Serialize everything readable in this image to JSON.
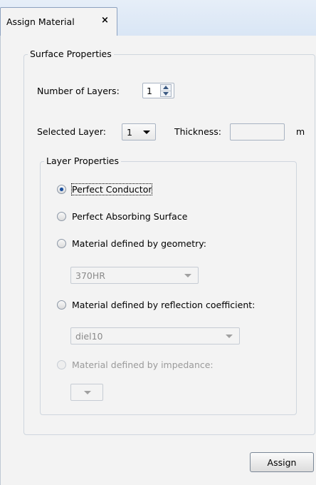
{
  "tab": {
    "title": "Assign Material",
    "close_label": "×"
  },
  "surface_properties": {
    "title": "Surface Properties",
    "number_of_layers_label": "Number of Layers:",
    "number_of_layers_value": "1",
    "selected_layer_label": "Selected Layer:",
    "selected_layer_value": "1",
    "thickness_label": "Thickness:",
    "thickness_value": "",
    "thickness_unit": "m"
  },
  "layer_properties": {
    "title": "Layer Properties",
    "options": [
      {
        "label": "Perfect Conductor",
        "checked": true,
        "enabled": true
      },
      {
        "label": "Perfect Absorbing Surface",
        "checked": false,
        "enabled": true
      },
      {
        "label": "Material defined by geometry:",
        "checked": false,
        "enabled": true
      },
      {
        "label": "Material defined by reflection coefficient:",
        "checked": false,
        "enabled": true
      },
      {
        "label": "Material defined by impedance:",
        "checked": false,
        "enabled": false
      }
    ],
    "geometry_material": "370HR",
    "reflection_material": "diel10",
    "impedance_material": ""
  },
  "actions": {
    "assign_label": "Assign"
  }
}
